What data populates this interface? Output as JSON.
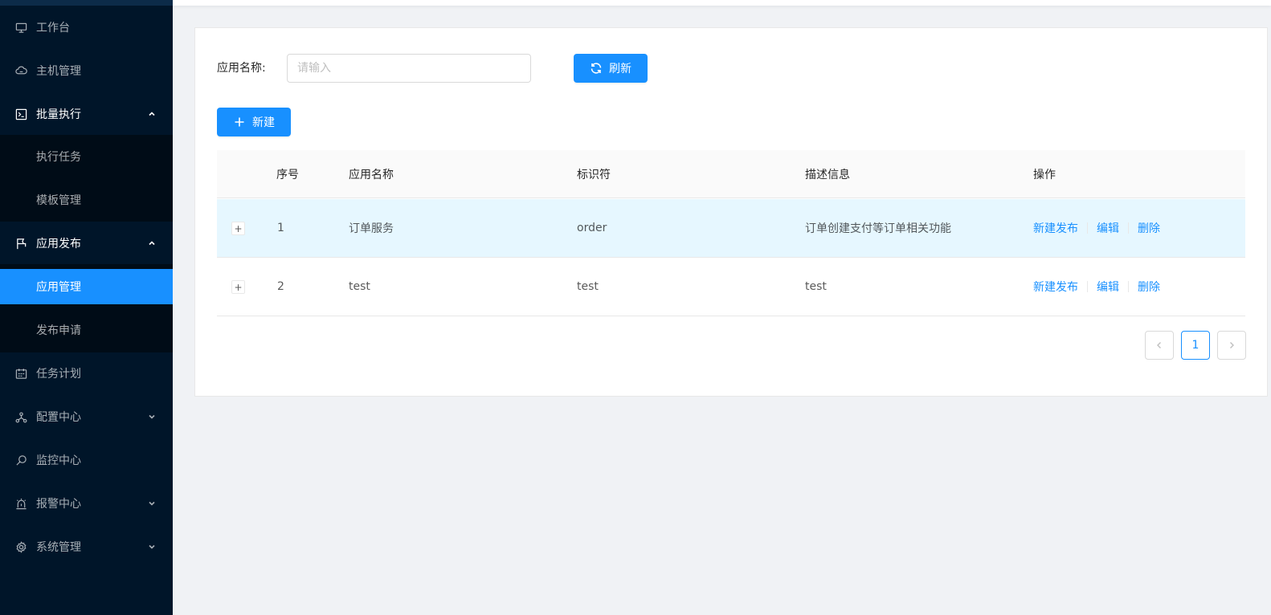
{
  "sidebar": {
    "items": [
      {
        "label": "工作台",
        "icon": "desktop-icon"
      },
      {
        "label": "主机管理",
        "icon": "cloud-server-icon"
      },
      {
        "label": "批量执行",
        "icon": "code-icon",
        "expanded": true,
        "children": [
          {
            "label": "执行任务"
          },
          {
            "label": "模板管理"
          }
        ]
      },
      {
        "label": "应用发布",
        "icon": "flag-icon",
        "expanded": true,
        "children": [
          {
            "label": "应用管理",
            "active": true
          },
          {
            "label": "发布申请"
          }
        ]
      },
      {
        "label": "任务计划",
        "icon": "schedule-icon"
      },
      {
        "label": "配置中心",
        "icon": "deployment-unit-icon",
        "collapsed": true
      },
      {
        "label": "监控中心",
        "icon": "monitor-search-icon"
      },
      {
        "label": "报警中心",
        "icon": "alarm-icon",
        "collapsed": true
      },
      {
        "label": "系统管理",
        "icon": "setting-icon",
        "collapsed": true
      }
    ]
  },
  "search": {
    "label": "应用名称:",
    "placeholder": "请输入",
    "value": ""
  },
  "toolbar": {
    "refresh_label": "刷新",
    "new_label": "新建"
  },
  "table": {
    "columns": [
      "序号",
      "应用名称",
      "标识符",
      "描述信息",
      "操作"
    ],
    "rows": [
      {
        "index": "1",
        "name": "订单服务",
        "key": "order",
        "desc": "订单创建支付等订单相关功能"
      },
      {
        "index": "2",
        "name": "test",
        "key": "test",
        "desc": "test"
      }
    ],
    "actions": [
      "新建发布",
      "编辑",
      "删除"
    ]
  },
  "pagination": {
    "current": "1"
  },
  "colors": {
    "primary": "#1890ff",
    "sidebar_bg": "#001529",
    "submenu_bg": "#000c17",
    "row_highlight": "#e6f7ff"
  }
}
